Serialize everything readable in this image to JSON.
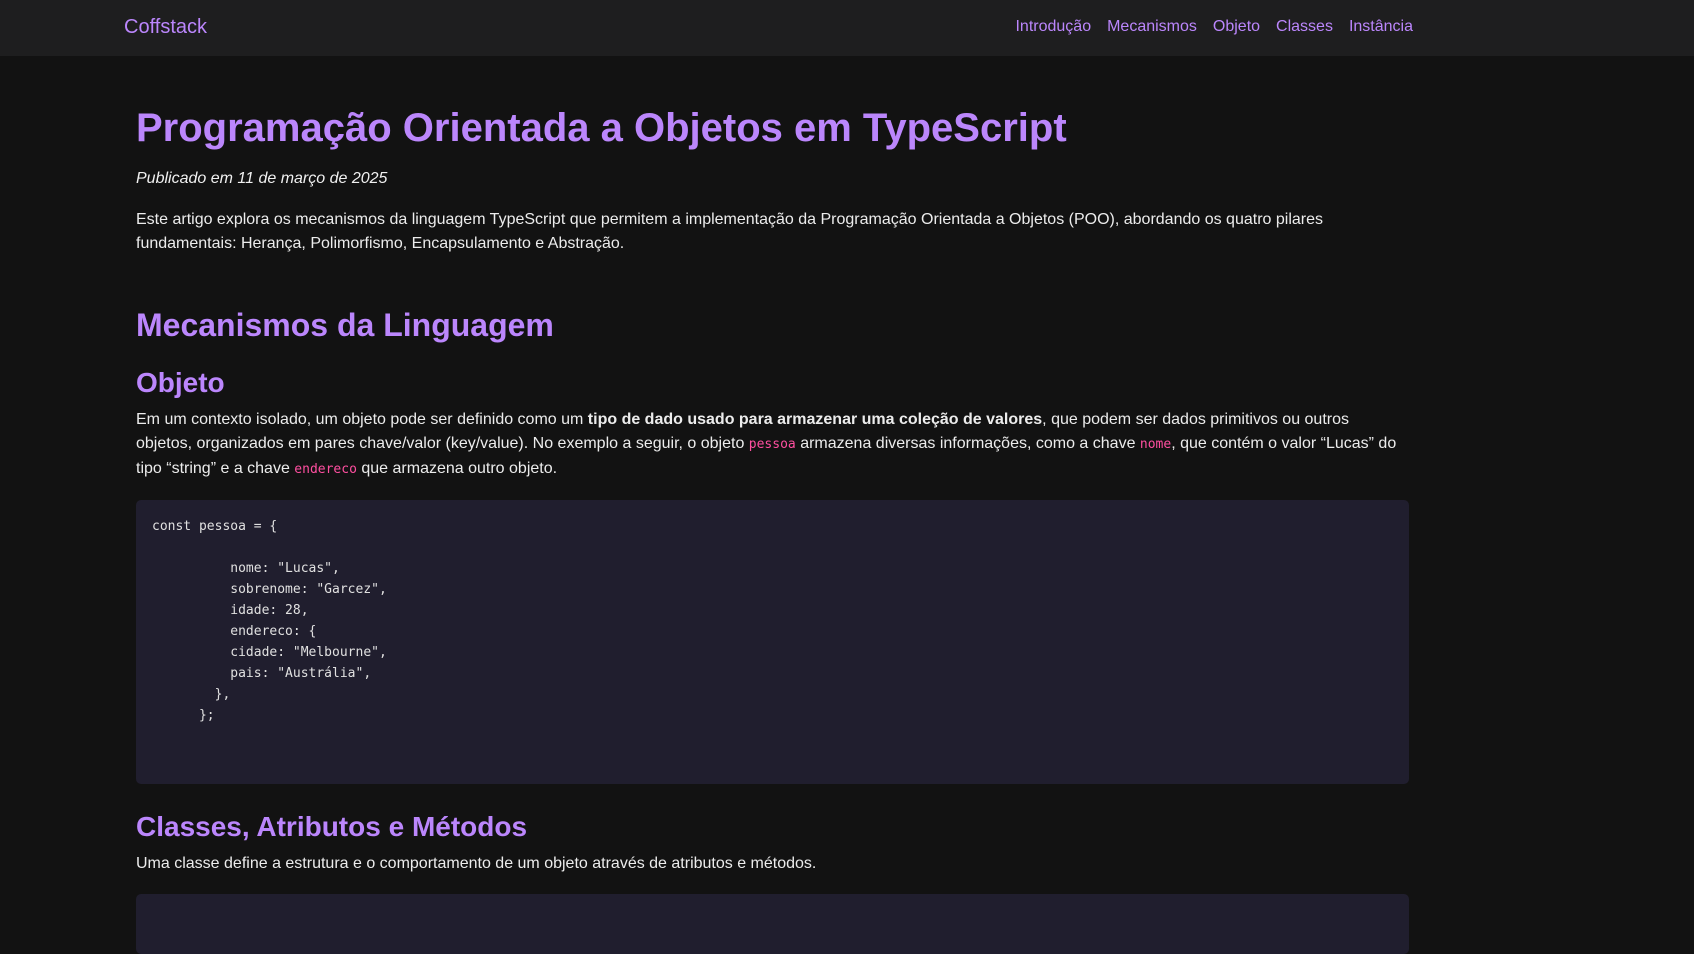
{
  "nav": {
    "brand": "Coffstack",
    "links": [
      "Introdução",
      "Mecanismos",
      "Objeto",
      "Classes",
      "Instância"
    ]
  },
  "article": {
    "title": "Programação Orientada a Objetos em TypeScript",
    "published": "Publicado em 11 de março de 2025",
    "intro": "Este artigo explora os mecanismos da linguagem TypeScript que permitem a implementação da Programação Orientada a Objetos (POO), abordando os quatro pilares fundamentais: Herança, Polimorfismo, Encapsulamento e Abstração."
  },
  "section_mecanismos": {
    "heading": "Mecanismos da Linguagem"
  },
  "section_objeto": {
    "heading": "Objeto",
    "text_1": "Em um contexto isolado, um objeto pode ser definido como um ",
    "text_bold": "tipo de dado usado para armazenar uma coleção de valores",
    "text_2": ", que podem ser dados primitivos ou outros objetos, organizados em pares chave/valor (key/value). No exemplo a seguir, o objeto ",
    "code_1": "pessoa",
    "text_3": " armazena diversas informações, como a chave ",
    "code_2": "nome",
    "text_4": ", que contém o valor “Lucas” do tipo “string” e a chave ",
    "code_3": "endereco",
    "text_5": " que armazena outro objeto.",
    "code_block": "const pessoa = {\n\n          nome: \"Lucas\",\n          sobrenome: \"Garcez\",\n          idade: 28,\n          endereco: {\n          cidade: \"Melbourne\",\n          pais: \"Austrália\",\n        },\n      };"
  },
  "section_classes": {
    "heading": "Classes, Atributos e Métodos",
    "text": "Uma classe define a estrutura e o comportamento de um objeto através de atributos e métodos."
  },
  "colors": {
    "accent": "#bb86fc",
    "inline_code": "#ff4fa0",
    "background": "#121212",
    "navbar": "#1e1e1f",
    "code_background": "#201e2e"
  }
}
